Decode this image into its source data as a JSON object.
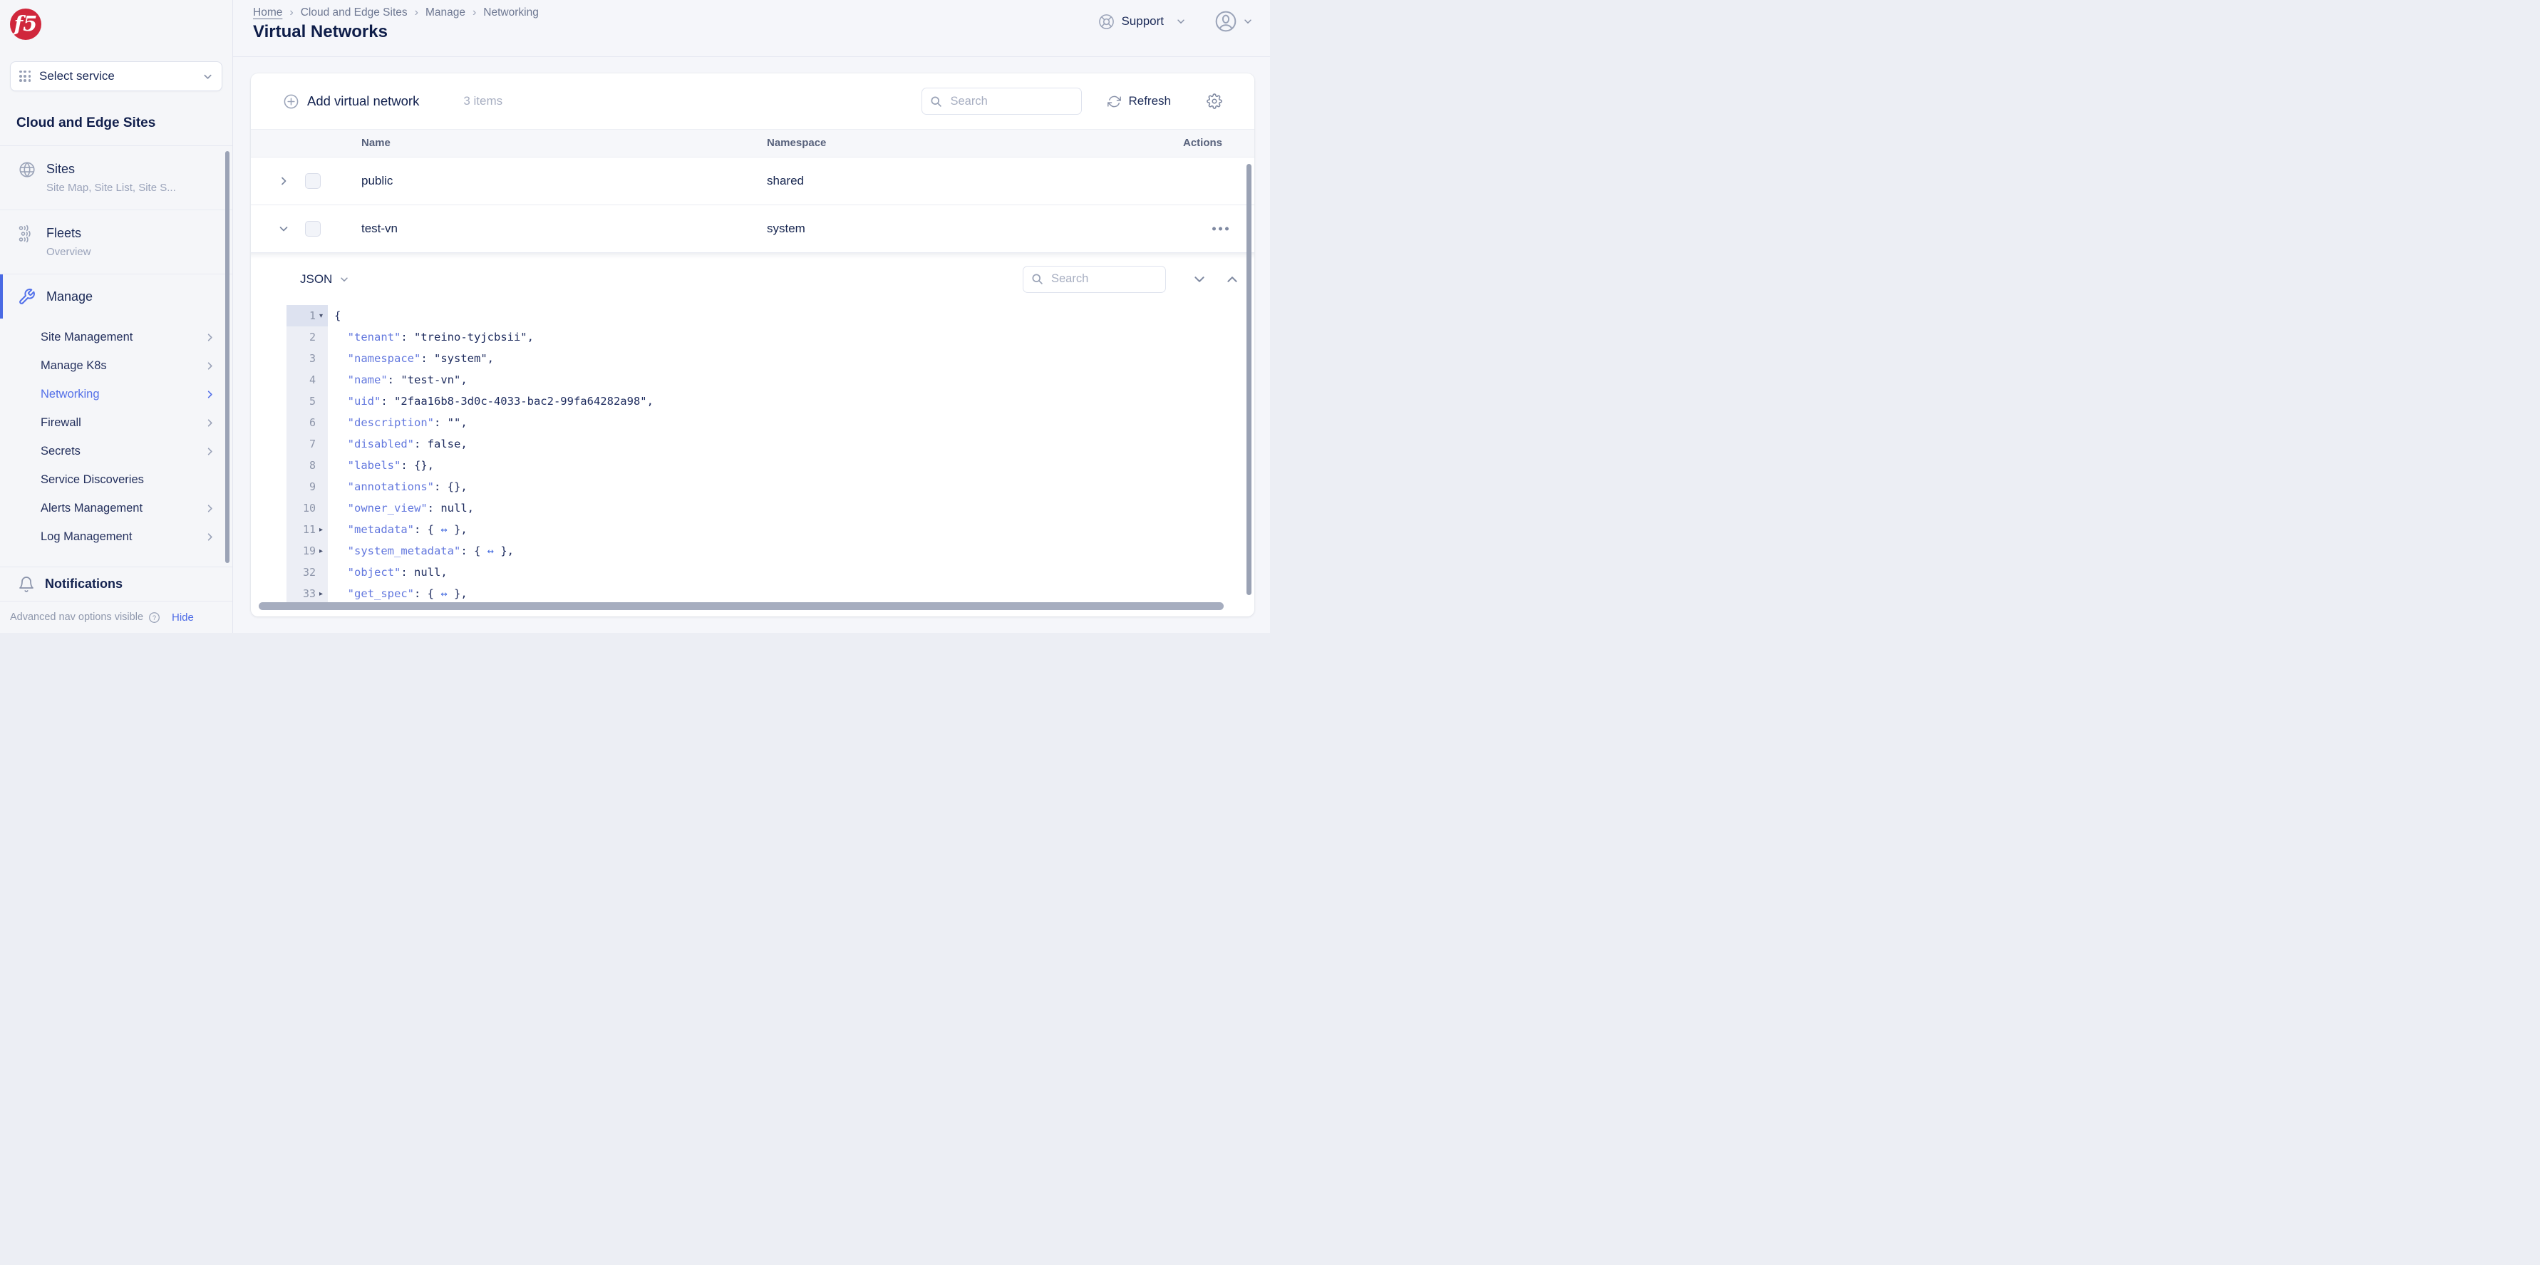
{
  "brand": {
    "logo_text": "f5"
  },
  "sidebar": {
    "service_selector": {
      "label": "Select service"
    },
    "heading": "Cloud and Edge Sites",
    "items": [
      {
        "label": "Sites",
        "subtitle": "Site Map, Site List, Site S..."
      },
      {
        "label": "Fleets",
        "subtitle": "Overview"
      },
      {
        "label": "Manage"
      }
    ],
    "subitems": [
      {
        "label": "Site Management"
      },
      {
        "label": "Manage K8s"
      },
      {
        "label": "Networking"
      },
      {
        "label": "Firewall"
      },
      {
        "label": "Secrets"
      },
      {
        "label": "Service Discoveries"
      },
      {
        "label": "Alerts Management"
      },
      {
        "label": "Log Management"
      }
    ],
    "notifications_label": "Notifications",
    "footer": {
      "status": "Advanced nav options visible",
      "action": "Hide"
    }
  },
  "header": {
    "breadcrumb": [
      "Home",
      "Cloud and Edge Sites",
      "Manage",
      "Networking"
    ],
    "title": "Virtual Networks",
    "support_label": "Support"
  },
  "toolbar": {
    "add_label": "Add virtual network",
    "items_count": "3 items",
    "search_placeholder": "Search",
    "refresh_label": "Refresh"
  },
  "table": {
    "columns": [
      "Name",
      "Namespace",
      "Actions"
    ],
    "rows": [
      {
        "name": "public",
        "namespace": "shared"
      },
      {
        "name": "test-vn",
        "namespace": "system"
      }
    ]
  },
  "json_viewer": {
    "mode_label": "JSON",
    "search_placeholder": "Search",
    "lines": [
      {
        "num": "1",
        "caret": "▾",
        "v1": "{"
      },
      {
        "num": "2",
        "key": "  \"tenant\"",
        "sep": ": ",
        "v1": "\"treino-tyjcbsii\","
      },
      {
        "num": "3",
        "key": "  \"namespace\"",
        "sep": ": ",
        "v1": "\"system\","
      },
      {
        "num": "4",
        "key": "  \"name\"",
        "sep": ": ",
        "v1": "\"test-vn\","
      },
      {
        "num": "5",
        "key": "  \"uid\"",
        "sep": ": ",
        "v1": "\"2faa16b8-3d0c-4033-bac2-99fa64282a98\","
      },
      {
        "num": "6",
        "key": "  \"description\"",
        "sep": ": ",
        "v1": "\"\","
      },
      {
        "num": "7",
        "key": "  \"disabled\"",
        "sep": ": ",
        "v1": "false,"
      },
      {
        "num": "8",
        "key": "  \"labels\"",
        "sep": ": ",
        "v1": "{},"
      },
      {
        "num": "9",
        "key": "  \"annotations\"",
        "sep": ": ",
        "v1": "{},"
      },
      {
        "num": "10",
        "key": "  \"owner_view\"",
        "sep": ": ",
        "v1": "null,"
      },
      {
        "num": "11",
        "caret": "▸",
        "key": "  \"metadata\"",
        "sep": ": ",
        "v1": "{ ",
        "arrow": "↔",
        "v2": " },"
      },
      {
        "num": "19",
        "caret": "▸",
        "key": "  \"system_metadata\"",
        "sep": ": ",
        "v1": "{ ",
        "arrow": "↔",
        "v2": " },"
      },
      {
        "num": "32",
        "key": "  \"object\"",
        "sep": ": ",
        "v1": "null,"
      },
      {
        "num": "33",
        "caret": "▸",
        "key": "  \"get_spec\"",
        "sep": ": ",
        "v1": "{ ",
        "arrow": "↔",
        "v2": " },"
      }
    ]
  },
  "colors": {
    "accent": "#4a6ae4",
    "json_key": "#6378de",
    "json_value": "#1d2b5e",
    "brand_red": "#d0273c"
  }
}
